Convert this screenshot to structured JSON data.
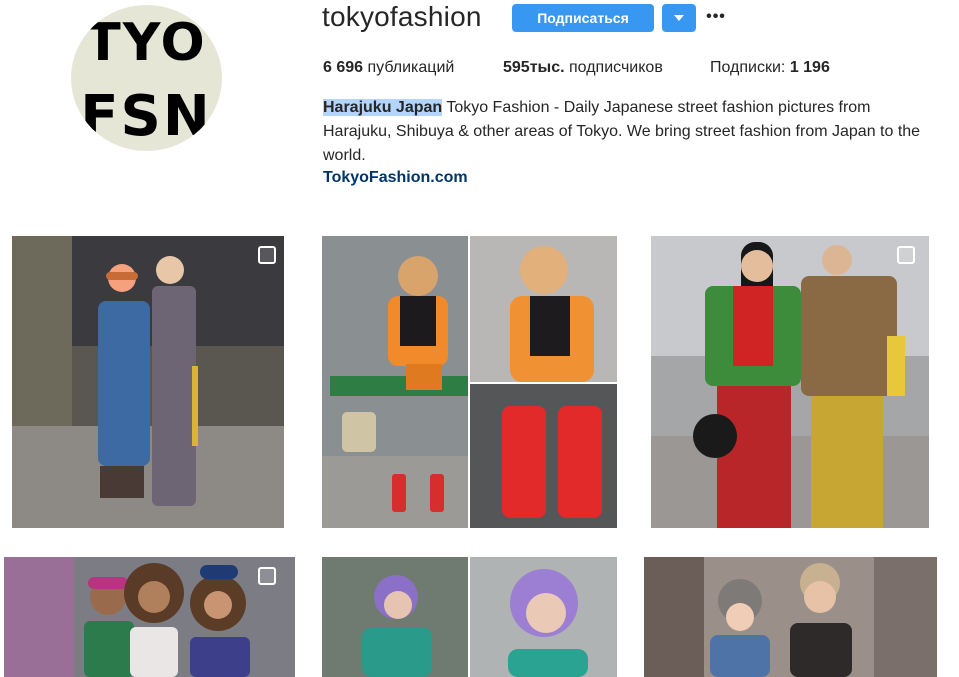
{
  "profile": {
    "avatar_text_line1": "TYO",
    "avatar_text_line2": "FSN",
    "username": "tokyofashion",
    "follow_label": "Подписаться",
    "dropdown_icon": "caret-down-icon",
    "more_label": "•••",
    "colors": {
      "accent": "#3897f0",
      "link": "#003569",
      "highlight": "#b3d4fc"
    }
  },
  "stats": {
    "posts_value": "6 696",
    "posts_label": " публикаций",
    "followers_value": "595тыс.",
    "followers_label": " подписчиков",
    "following_label": "Подписки: ",
    "following_value": "1 196"
  },
  "bio": {
    "name": "Harajuku Japan",
    "text": " Tokyo Fashion - Daily Japanese street fashion pictures from Harajuku, Shibuya & other areas of Tokyo. We bring street fashion from Japan to the world.",
    "link": "TokyoFashion.com"
  },
  "grid": {
    "posts": [
      {
        "alt": "two-people-street-fashion-photo",
        "multiple": true
      },
      {
        "alt": "orange-jacket-red-boots-collage",
        "multiple": false
      },
      {
        "alt": "pair-in-plaid-and-leopard-photo",
        "multiple": true
      },
      {
        "alt": "group-of-three-street-photo",
        "multiple": true
      },
      {
        "alt": "purple-hair-collage",
        "multiple": false
      },
      {
        "alt": "two-children-street-photo",
        "multiple": false
      }
    ]
  }
}
